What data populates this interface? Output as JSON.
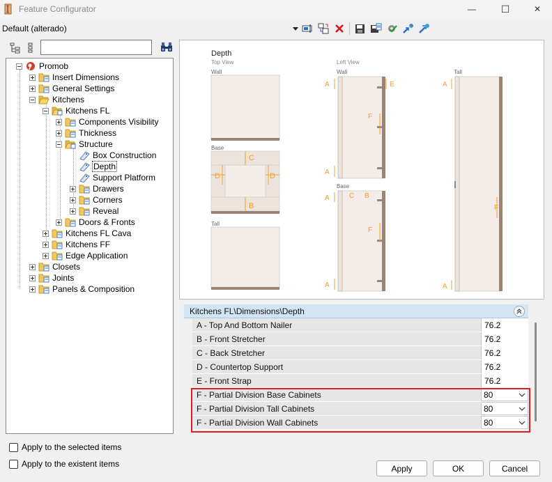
{
  "window": {
    "title": "Feature Configurator",
    "minimize": "—",
    "maximize": "☐",
    "close": "✕"
  },
  "toolbar": {
    "configuration": "Default (alterado)"
  },
  "search": {
    "value": ""
  },
  "tree": {
    "root": "Promob",
    "insert_dimensions": "Insert Dimensions",
    "general_settings": "General Settings",
    "kitchens": "Kitchens",
    "kitchens_fl": "Kitchens FL",
    "components_visibility": "Components Visibility",
    "thickness": "Thickness",
    "structure": "Structure",
    "box_construction": "Box Construction",
    "depth": "Depth",
    "support_platform": "Support Platform",
    "drawers": "Drawers",
    "corners": "Corners",
    "reveal": "Reveal",
    "doors_fronts": "Doors & Fronts",
    "kitchens_fl_cava": "Kitchens FL Cava",
    "kitchens_ff": "Kitchens FF",
    "edge_application": "Edge Application",
    "closets": "Closets",
    "joints": "Joints",
    "panels_composition": "Panels & Composition"
  },
  "preview": {
    "title": "Depth",
    "top_view": "Top View",
    "left_view": "Left View",
    "wall": "Wall",
    "base": "Base",
    "tall": "Tall",
    "labels": {
      "a": "A",
      "b": "B",
      "c": "C",
      "d": "D",
      "e": "E",
      "f": "F"
    }
  },
  "properties": {
    "path": "Kitchens FL\\Dimensions\\Depth",
    "rows": [
      {
        "label": "A - Top And Bottom Nailer",
        "value": "76.2"
      },
      {
        "label": "B - Front Stretcher",
        "value": "76.2"
      },
      {
        "label": "C - Back Stretcher",
        "value": "76.2"
      },
      {
        "label": "D - Countertop Support",
        "value": "76.2"
      },
      {
        "label": "E - Front Strap",
        "value": "76.2"
      },
      {
        "label": "F - Partial Division Base Cabinets",
        "value": "80"
      },
      {
        "label": "F - Partial Division Tall Cabinets",
        "value": "80"
      },
      {
        "label": "F - Partial Division Wall Cabinets",
        "value": "80"
      }
    ]
  },
  "options": {
    "apply_selected": "Apply to the selected items",
    "apply_existent": "Apply to the existent items"
  },
  "buttons": {
    "apply": "Apply",
    "ok": "OK",
    "cancel": "Cancel"
  },
  "colors": {
    "accent_orange": "#f0a030",
    "highlight_red": "#e01c24",
    "panel_fill": "#f3ece8",
    "edge_brown": "#9b8375"
  }
}
